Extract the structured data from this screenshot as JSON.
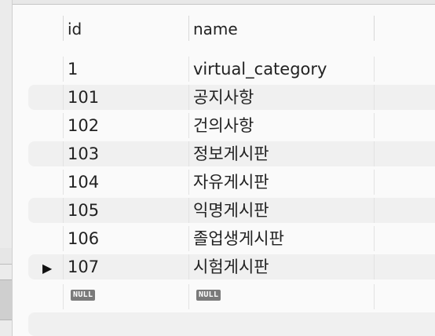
{
  "columns": {
    "id": "id",
    "name": "name"
  },
  "rows": [
    {
      "id": "1",
      "name": "virtual_category"
    },
    {
      "id": "101",
      "name": "공지사항"
    },
    {
      "id": "102",
      "name": "건의사항"
    },
    {
      "id": "103",
      "name": "정보게시판"
    },
    {
      "id": "104",
      "name": "자유게시판"
    },
    {
      "id": "105",
      "name": "익명게시판"
    },
    {
      "id": "106",
      "name": "졸업생게시판"
    },
    {
      "id": "107",
      "name": "시험게시판"
    }
  ],
  "new_row": {
    "id": "NULL",
    "name": "NULL"
  },
  "selected_row_marker": "▶",
  "colors": {
    "alt_row": "#f0f0f0",
    "null_badge": "#7a7a7a",
    "text": "#222222"
  }
}
